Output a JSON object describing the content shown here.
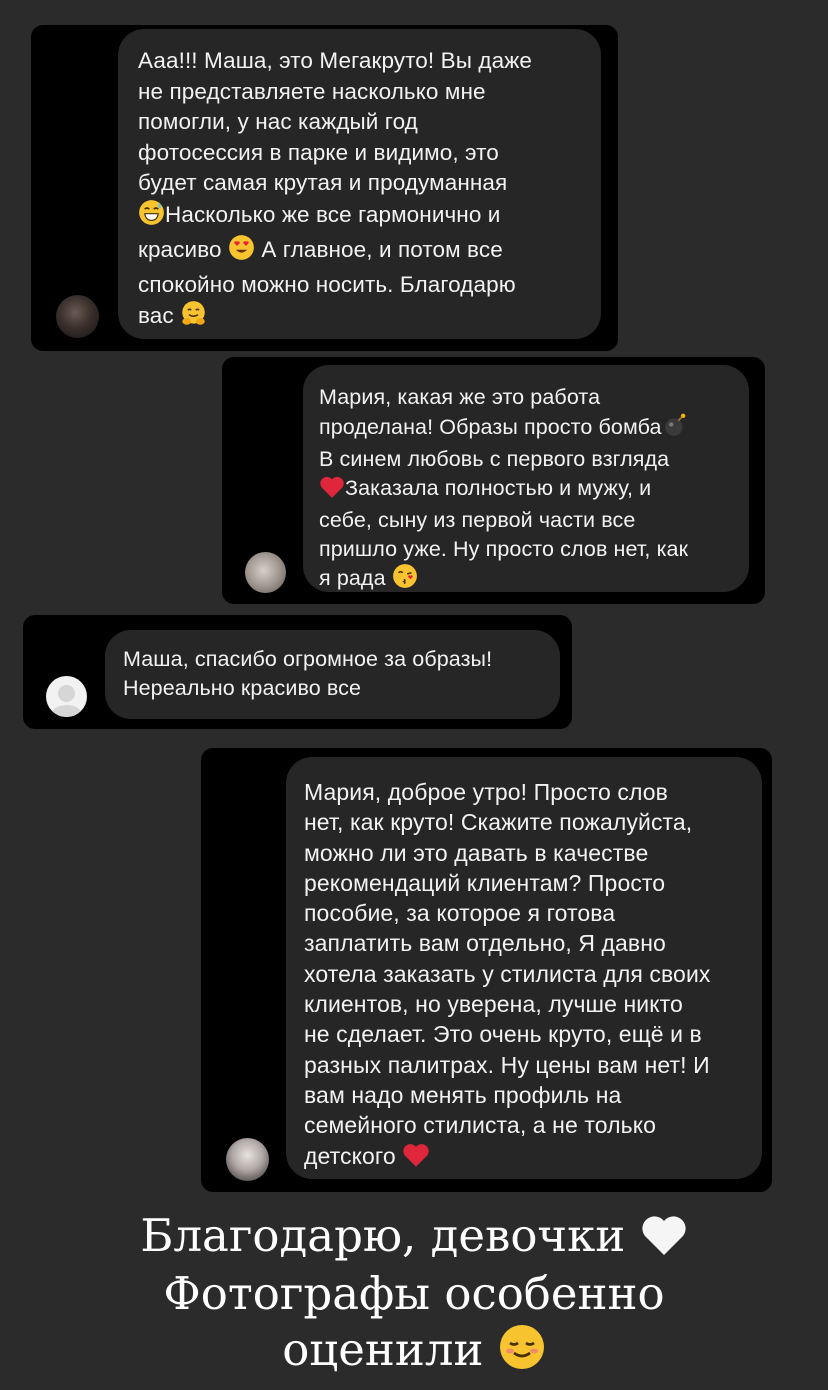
{
  "messages": [
    {
      "lines": [
        "Ааа!!! Маша, это Мегакруто! Вы даже",
        "не представляете насколько мне",
        "помогли, у нас каждый год",
        "фотосессия в парке и видимо, это",
        "будет самая крутая и продуманная",
        "Насколько же все гармонично и",
        "красиво",
        "А главное, и потом все",
        "спокойно можно носить. Благодарю",
        "вас"
      ],
      "emojis": [
        "sweat-smile-emoji",
        "heart-eyes-emoji",
        "hug-emoji"
      ]
    },
    {
      "lines": [
        "Мария, какая же это работа",
        "проделана! Образы просто бомба",
        "В синем любовь с первого взгляда",
        "Заказала полностью и мужу, и",
        "себе, сыну из первой части все",
        "пришло уже. Ну просто слов нет, как",
        "я рада"
      ],
      "emojis": [
        "bomb-emoji",
        "red-heart-emoji",
        "kiss-emoji"
      ]
    },
    {
      "lines": [
        "Маша, спасибо огромное за образы!",
        "Нереально красиво все"
      ],
      "emojis": []
    },
    {
      "lines": [
        "Мария, доброе утро! Просто слов",
        "нет, как круто! Скажите пожалуйста,",
        "можно ли это давать в качестве",
        "рекомендаций клиентам? Просто",
        "пособие, за которое я готова",
        "заплатить вам отдельно, Я давно",
        "хотела заказать у стилиста для своих",
        "клиентов, но уверена, лучше никто",
        "не сделает. Это очень круто, ещё и в",
        "разных палитрах. Ну цены вам нет! И",
        "вам надо менять профиль на",
        "семейного стилиста, а не только",
        "детского"
      ],
      "emojis": [
        "red-heart-emoji"
      ]
    }
  ],
  "caption": {
    "line1": "Благодарю, девочки",
    "line2": "Фотографы особенно",
    "line3": "оценили"
  },
  "colors": {
    "story_background": "#2b2b2b",
    "screenshot_background": "#000000",
    "bubble_background": "#262626",
    "text": "#f2f2f2"
  }
}
